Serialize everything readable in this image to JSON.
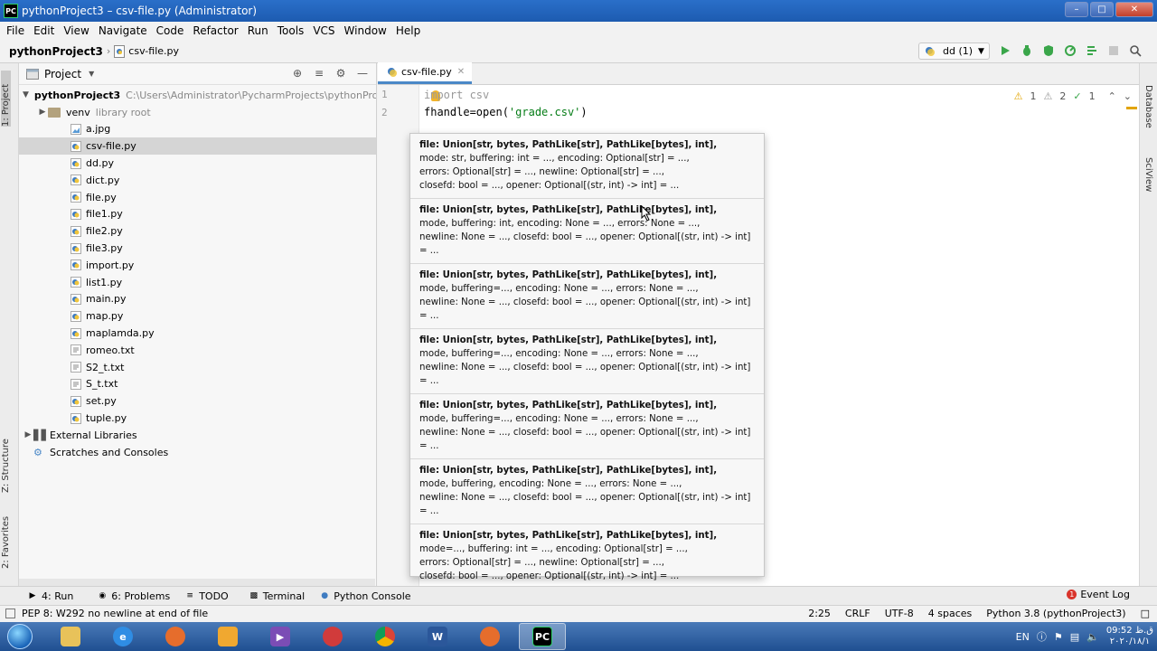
{
  "window": {
    "title": "pythonProject3 – csv-file.py (Administrator)",
    "app_icon": "PC",
    "controls": [
      "minimize",
      "maximize",
      "close"
    ]
  },
  "menu": {
    "items": [
      "File",
      "Edit",
      "View",
      "Navigate",
      "Code",
      "Refactor",
      "Run",
      "Tools",
      "VCS",
      "Window",
      "Help"
    ]
  },
  "navbar": {
    "project": "pythonProject3",
    "file": "csv-file.py",
    "run_config": "dd (1)"
  },
  "left_strip": {
    "project_tab": "1: Project",
    "structure_tab": "Z: Structure",
    "favorites_tab": "2: Favorites"
  },
  "right_strip": {
    "database_tab": "Database",
    "sciview_tab": "SciView"
  },
  "project_panel": {
    "header": "Project",
    "root_name": "pythonProject3",
    "root_path": "C:\\Users\\Administrator\\PycharmProjects\\pythonProje",
    "venv_name": "venv",
    "venv_note": "library root",
    "files": [
      "a.jpg",
      "csv-file.py",
      "dd.py",
      "dict.py",
      "file.py",
      "file1.py",
      "file2.py",
      "file3.py",
      "import.py",
      "list1.py",
      "main.py",
      "map.py",
      "maplamda.py",
      "romeo.txt",
      "S2_t.txt",
      "S_t.txt",
      "set.py",
      "tuple.py"
    ],
    "selected_file": "csv-file.py",
    "external_libraries": "External Libraries",
    "scratches": "Scratches and Consoles"
  },
  "editor": {
    "tab_label": "csv-file.py",
    "line_numbers": [
      "1",
      "2"
    ],
    "line1_prefix": "i",
    "line1_dim": "mport csv",
    "line2_code": "fhandle=open(",
    "line2_string": "'grade.csv'",
    "line2_end": ")",
    "inspections": {
      "warnings": "1",
      "weak_warnings": "2",
      "typos": "1"
    }
  },
  "popup": {
    "signatures": [
      {
        "head": "file: Union[str, bytes, PathLike[str], PathLike[bytes], int],",
        "lines": [
          "mode: str, buffering: int = ..., encoding: Optional[str] = ...,",
          "errors: Optional[str] = ..., newline: Optional[str] = ...,",
          "closefd: bool = ..., opener: Optional[(str, int) -> int] = ..."
        ]
      },
      {
        "head": "file: Union[str, bytes, PathLike[str], PathLike[bytes], int],",
        "lines": [
          "mode, buffering: int, encoding: None = ..., errors: None = ...,",
          "newline: None = ..., closefd: bool = ..., opener: Optional[(str, int) -> int] = ..."
        ]
      },
      {
        "head": "file: Union[str, bytes, PathLike[str], PathLike[bytes], int],",
        "lines": [
          "mode, buffering=..., encoding: None = ..., errors: None = ...,",
          "newline: None = ..., closefd: bool = ..., opener: Optional[(str, int) -> int] = ..."
        ]
      },
      {
        "head": "file: Union[str, bytes, PathLike[str], PathLike[bytes], int],",
        "lines": [
          "mode, buffering=..., encoding: None = ..., errors: None = ...,",
          "newline: None = ..., closefd: bool = ..., opener: Optional[(str, int) -> int] = ..."
        ]
      },
      {
        "head": "file: Union[str, bytes, PathLike[str], PathLike[bytes], int],",
        "lines": [
          "mode, buffering=..., encoding: None = ..., errors: None = ...,",
          "newline: None = ..., closefd: bool = ..., opener: Optional[(str, int) -> int] = ..."
        ]
      },
      {
        "head": "file: Union[str, bytes, PathLike[str], PathLike[bytes], int],",
        "lines": [
          "mode, buffering, encoding: None = ..., errors: None = ...,",
          "newline: None = ..., closefd: bool = ..., opener: Optional[(str, int) -> int] = ..."
        ]
      },
      {
        "head": "file: Union[str, bytes, PathLike[str], PathLike[bytes], int],",
        "lines": [
          "mode=..., buffering: int = ..., encoding: Optional[str] = ...,",
          "errors: Optional[str] = ..., newline: Optional[str] = ...,",
          "closefd: bool = ..., opener: Optional[(str, int) -> int] = ..."
        ]
      }
    ]
  },
  "bottom_tools": {
    "run": "4: Run",
    "problems": "6: Problems",
    "todo": "TODO",
    "terminal": "Terminal",
    "python_console": "Python Console",
    "event_log": "Event Log",
    "event_count": "1"
  },
  "status": {
    "message": "PEP 8: W292 no newline at end of file",
    "position": "2:25",
    "line_sep": "CRLF",
    "encoding": "UTF-8",
    "indent": "4 spaces",
    "interpreter": "Python 3.8 (pythonProject3)"
  },
  "taskbar": {
    "apps": [
      "ie",
      "firefox",
      "explorer",
      "media",
      "paint",
      "chrome",
      "word",
      "firefox2",
      "pycharm"
    ],
    "language": "EN",
    "time": "09:52 ق.ظ",
    "date": "۲۰۲۰/۱۸/۱"
  },
  "colors": {
    "accent": "#4a88c7",
    "string": "#067d17",
    "warning": "#e2a400",
    "error": "#d9342b"
  }
}
